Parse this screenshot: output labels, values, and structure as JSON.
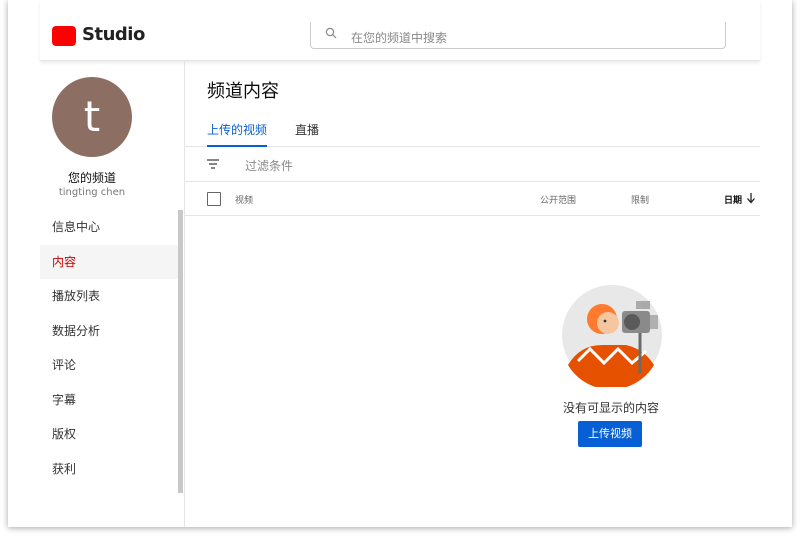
{
  "header": {
    "logo_text": "Studio",
    "search_placeholder": "在您的频道中搜索"
  },
  "sidebar": {
    "avatar_letter": "t",
    "channel_name": "您的频道",
    "user_name": "tingting chen",
    "items": [
      {
        "label": "信息中心"
      },
      {
        "label": "内容"
      },
      {
        "label": "播放列表"
      },
      {
        "label": "数据分析"
      },
      {
        "label": "评论"
      },
      {
        "label": "字幕"
      },
      {
        "label": "版权"
      },
      {
        "label": "获利"
      }
    ]
  },
  "main": {
    "title": "频道内容",
    "tabs": [
      {
        "label": "上传的视频"
      },
      {
        "label": "直播"
      }
    ],
    "filter_placeholder": "过滤条件",
    "columns": {
      "video": "视频",
      "visibility": "公开范围",
      "restrictions": "限制",
      "date": "日期"
    },
    "empty_text": "没有可显示的内容",
    "upload_button": "上传视频"
  },
  "colors": {
    "accent": "#065fd4",
    "active_nav": "#cc0000",
    "logo_red": "#ff0000"
  }
}
